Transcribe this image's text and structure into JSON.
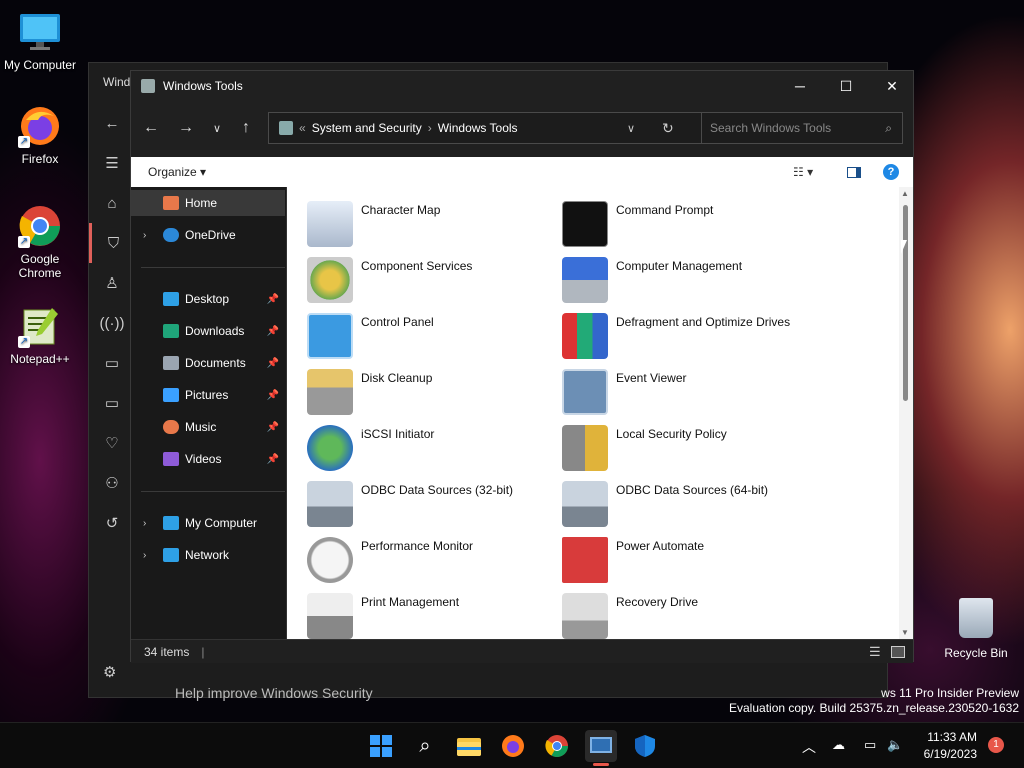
{
  "desktop": {
    "icons": [
      {
        "label": "My Computer"
      },
      {
        "label": "Firefox"
      },
      {
        "label": "Google Chrome"
      },
      {
        "label": "Notepad++"
      }
    ],
    "recycle_bin": "Recycle Bin"
  },
  "background_window": {
    "title": "Windo",
    "footer_text": "Help improve Windows Security"
  },
  "explorer": {
    "title": "Windows Tools",
    "controls": {
      "minimize": "─",
      "maximize": "☐",
      "close": "✕"
    },
    "address": {
      "prefix": "«",
      "crumbs": [
        "System and Security",
        "Windows Tools"
      ]
    },
    "search_placeholder": "Search Windows Tools",
    "toolbar": {
      "organize": "Organize ▾"
    },
    "sidebar": [
      {
        "label": "Home"
      },
      {
        "label": "OneDrive"
      },
      {
        "label": "Desktop"
      },
      {
        "label": "Downloads"
      },
      {
        "label": "Documents"
      },
      {
        "label": "Pictures"
      },
      {
        "label": "Music"
      },
      {
        "label": "Videos"
      },
      {
        "label": "My Computer"
      },
      {
        "label": "Network"
      }
    ],
    "items": [
      {
        "label": "Character Map",
        "icon": "character-map-icon"
      },
      {
        "label": "Command Prompt",
        "icon": "command-prompt-icon"
      },
      {
        "label": "Component Services",
        "icon": "component-services-icon"
      },
      {
        "label": "Computer Management",
        "icon": "computer-management-icon"
      },
      {
        "label": "Control Panel",
        "icon": "control-panel-icon"
      },
      {
        "label": "Defragment and Optimize Drives",
        "icon": "defragment-icon"
      },
      {
        "label": "Disk Cleanup",
        "icon": "disk-cleanup-icon"
      },
      {
        "label": "Event Viewer",
        "icon": "event-viewer-icon"
      },
      {
        "label": "iSCSI Initiator",
        "icon": "iscsi-icon"
      },
      {
        "label": "Local Security Policy",
        "icon": "security-policy-icon"
      },
      {
        "label": "ODBC Data Sources (32-bit)",
        "icon": "odbc-32-icon"
      },
      {
        "label": "ODBC Data Sources (64-bit)",
        "icon": "odbc-64-icon"
      },
      {
        "label": "Performance Monitor",
        "icon": "performance-monitor-icon"
      },
      {
        "label": "Power Automate",
        "icon": "power-automate-icon"
      },
      {
        "label": "Print Management",
        "icon": "print-management-icon"
      },
      {
        "label": "Recovery Drive",
        "icon": "recovery-drive-icon"
      }
    ],
    "status": "34 items"
  },
  "watermark": {
    "line1": "ws 11 Pro Insider Preview",
    "line2": "Evaluation copy. Build 25375.zn_release.230520-1632"
  },
  "taskbar": {
    "time": "11:33 AM",
    "date": "6/19/2023",
    "notification_count": "1"
  }
}
